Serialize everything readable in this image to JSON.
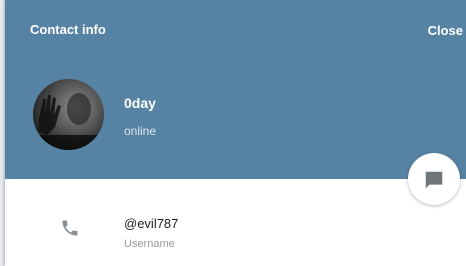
{
  "header": {
    "title": "Contact info",
    "close_label": "Close"
  },
  "peer": {
    "name": "0day",
    "status": "online"
  },
  "info": {
    "username_value": "@evil787",
    "username_label": "Username"
  },
  "icons": {
    "message_button": "message-icon",
    "phone": "phone-icon"
  },
  "colors": {
    "header_bg": "#5682a3",
    "text_secondary": "#9a9a9a"
  }
}
